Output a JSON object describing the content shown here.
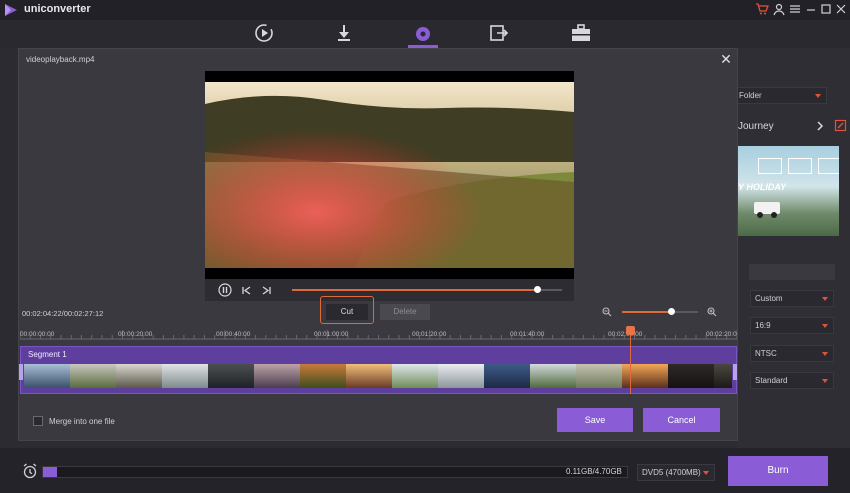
{
  "app": {
    "name": "uniconverter"
  },
  "window_controls": [
    "cart-icon",
    "account-icon",
    "menu-icon",
    "minimize-icon",
    "maximize-icon",
    "close-icon"
  ],
  "nav": {
    "tabs": [
      "convert-icon",
      "download-icon",
      "burn-icon",
      "transfer-icon",
      "toolbox-icon"
    ],
    "active_index": 2
  },
  "right_panel": {
    "folder_label": "Folder",
    "template_name": "Journey",
    "template_text": "Y HOLIDAY",
    "selects": [
      "Custom",
      "16:9",
      "NTSC",
      "Standard"
    ]
  },
  "dialog": {
    "title": "videoplayback.mp4",
    "time_readout": "00:02:04:22/00:02:27:12",
    "cut_label": "Cut",
    "delete_label": "Delete",
    "ruler_labels": [
      "00:00:00:00",
      "00:00:20:00",
      "00:00:40:00",
      "00:01:00:00",
      "00:01:20:00",
      "00:01:40:00",
      "00:02:00:00",
      "00:02:20:00"
    ],
    "segment_label": "Segment 1",
    "merge_label": "Merge into one file",
    "save_label": "Save",
    "cancel_label": "Cancel",
    "playback_progress": 0.91,
    "zoom_level": 0.65
  },
  "bottom": {
    "capacity": "0.11GB/4.70GB",
    "disc_type": "DVD5 (4700MB)",
    "burn_label": "Burn",
    "usage_fraction": 0.024
  },
  "colors": {
    "accent": "#8a5cd6",
    "highlight": "#e0693a"
  }
}
